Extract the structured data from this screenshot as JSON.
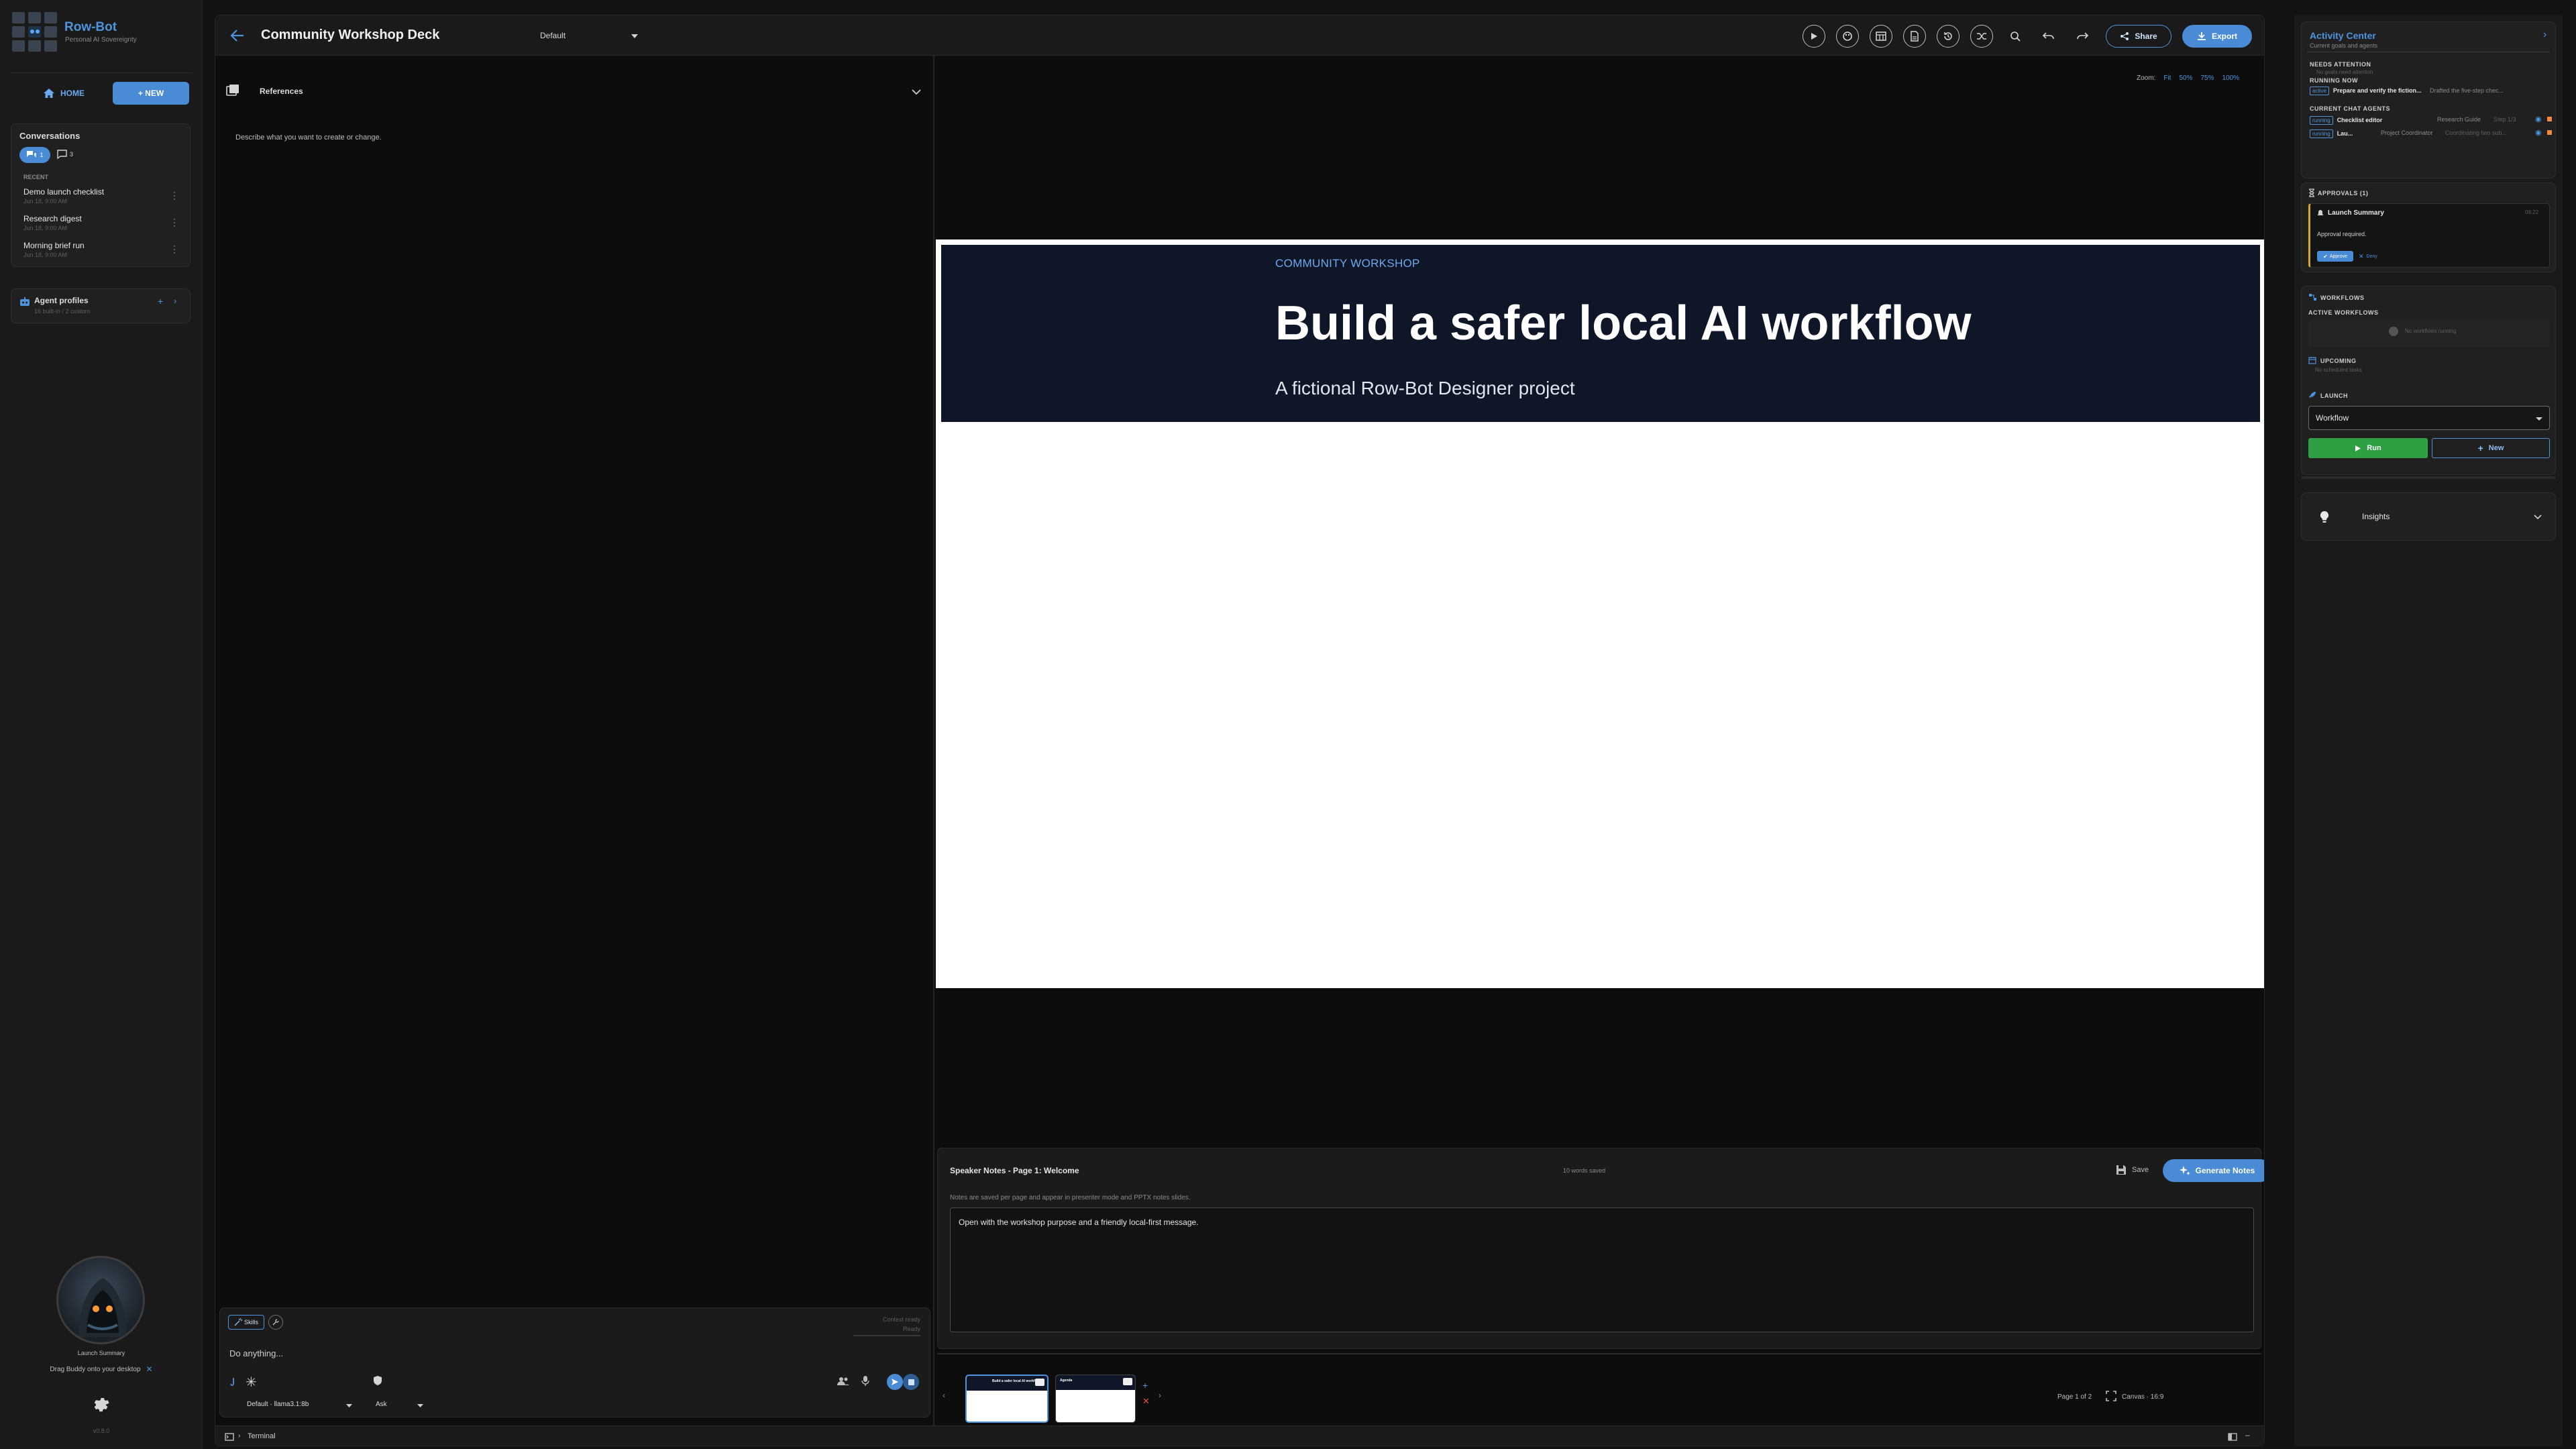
{
  "app": {
    "name": "Row-Bot",
    "tagline": "Personal AI Sovereignty",
    "version": "v0.8.0"
  },
  "sidebar": {
    "home_label": "HOME",
    "new_label": "+ NEW",
    "conversations_title": "Conversations",
    "conv_count": "1",
    "msg_count": "3",
    "recent_label": "RECENT",
    "items": [
      {
        "title": "Demo launch checklist",
        "time": "Jun 18, 9:00 AM"
      },
      {
        "title": "Research digest",
        "time": "Jun 18, 9:00 AM"
      },
      {
        "title": "Morning brief run",
        "time": "Jun 18, 9:00 AM"
      }
    ],
    "agent_profiles_title": "Agent profiles",
    "agent_profiles_sub": "16 built-in / 2 custom",
    "buddy_caption": "Launch Summary",
    "buddy_hint": "Drag Buddy onto your desktop"
  },
  "header": {
    "title": "Community Workshop Deck",
    "theme_select": "Default",
    "share_label": "Share",
    "export_label": "Export"
  },
  "left_panel": {
    "references_label": "References",
    "prompt_hint": "Describe what you want to create or change.",
    "skill_chip": "Skills",
    "context_status": "Context ready",
    "ready_status": "Ready",
    "input_placeholder": "Do anything...",
    "model_select": "Default · llama3.1:8b",
    "mode_select": "Ask"
  },
  "canvas": {
    "zoom_label": "Zoom:",
    "zoom_options": [
      "Fit",
      "50%",
      "75%",
      "100%"
    ],
    "slide": {
      "kicker": "COMMUNITY WORKSHOP",
      "title": "Build a safer local AI workflow",
      "subtitle": "A fictional Row-Bot Designer project"
    },
    "thumb_titles": [
      "Build a safer local AI workflow",
      "Agenda"
    ]
  },
  "notes": {
    "title": "Speaker Notes - Page 1: Welcome",
    "saved_status": "10 words saved",
    "save_label": "Save",
    "generate_label": "Generate Notes",
    "help_text": "Notes are saved per page and appear in presenter mode and PPTX notes slides.",
    "content": "Open with the workshop purpose and a friendly local-first message."
  },
  "footer": {
    "page_info": "Page 1 of 2",
    "canvas_info": "Canvas · 16:9",
    "terminal_label": "Terminal"
  },
  "activity": {
    "title": "Activity Center",
    "subtitle": "Current goals and agents",
    "needs_attention": "NEEDS ATTENTION",
    "needs_attention_empty": "No goals need attention",
    "running_now": "RUNNING NOW",
    "running_tag": "active",
    "running_text": "Prepare and verify the fiction...",
    "running_detail": "Drafted the five-step chec...",
    "agents_title": "CURRENT CHAT AGENTS",
    "agents": [
      {
        "tag": "running",
        "name": "Checklist editor",
        "role": "Research Guide",
        "detail": "Step 1/3"
      },
      {
        "tag": "running",
        "name": "Lau...",
        "role": "Project Coordinator",
        "detail": "Coordinating two sub..."
      }
    ]
  },
  "approvals": {
    "title": "APPROVALS (1)",
    "item_title": "Launch Summary",
    "item_time": "09:22",
    "item_text": "Approval required.",
    "approve_label": "Approve",
    "deny_label": "Deny"
  },
  "workflows": {
    "title": "WORKFLOWS",
    "active_title": "ACTIVE WORKFLOWS",
    "active_empty": "No workflows running",
    "upcoming_title": "UPCOMING",
    "upcoming_empty": "No scheduled tasks",
    "launch_title": "LAUNCH",
    "launch_select": "Workflow",
    "run_label": "Run",
    "new_label": "New"
  },
  "insights": {
    "title": "Insights"
  },
  "colors": {
    "accent": "#4d93dd",
    "slide_band": "#0e1628",
    "run_green": "#2ea043",
    "approval_yellow": "#d4a72c"
  }
}
